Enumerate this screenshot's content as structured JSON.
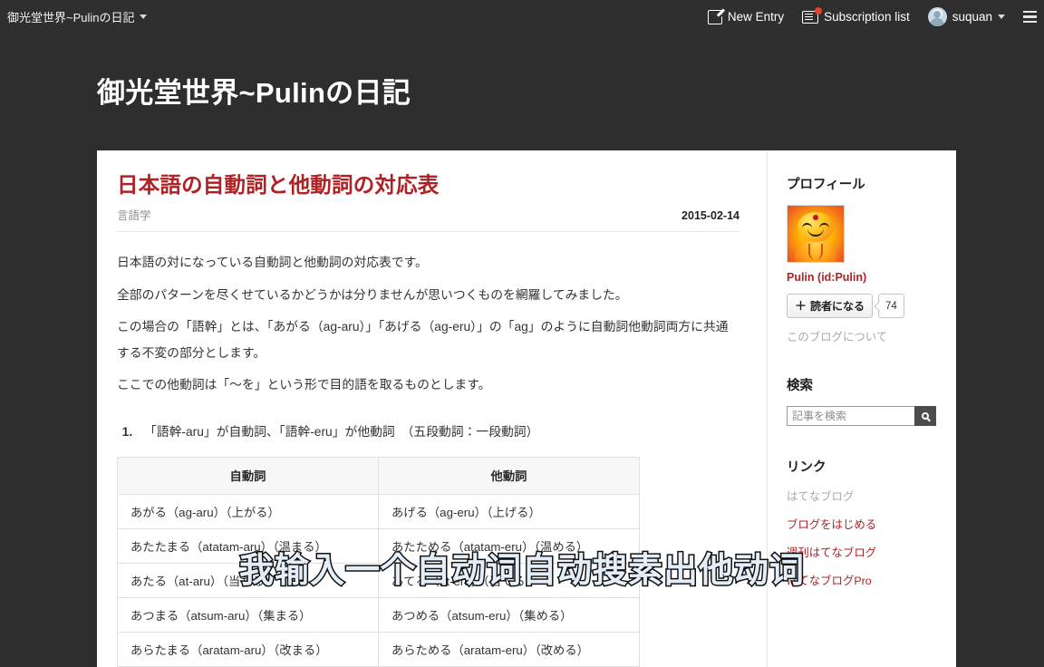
{
  "globalheader": {
    "blog_name": "御光堂世界~Pulinの日記",
    "new_entry_label": "New Entry",
    "subscription_label": "Subscription list",
    "user_name": "suquan"
  },
  "blog": {
    "title": "御光堂世界~Pulinの日記"
  },
  "entry": {
    "title": "日本語の自動詞と他動詞の対応表",
    "category": "言語学",
    "date": "2015-02-14",
    "paragraphs": [
      "日本語の対になっている自動詞と他動詞の対応表です。",
      "全部のパターンを尽くせているかどうかは分りませんが思いつくものを網羅してみました。",
      "この場合の「語幹」とは、「あがる（ag-aru）」「あげる（ag-eru）」の「ag」のように自動詞他動詞両方に共通する不変の部分とします。",
      "ここでの他動詞は「〜を」という形で目的語を取るものとします。"
    ],
    "rule_1": "「語幹-aru」が自動詞、「語幹-eru」が他動詞　（五段動詞：一段動詞）",
    "table": {
      "headers": [
        "自動詞",
        "他動詞"
      ],
      "rows": [
        [
          "あがる（ag-aru）（上がる）",
          "あげる（ag-eru）（上げる）"
        ],
        [
          "あたたまる（atatam-aru）（温まる）",
          "あたためる（atatam-eru）（温める）"
        ],
        [
          "あたる（at-aru）（当たる）",
          "あてる（at-eru）（当てる）"
        ],
        [
          "あつまる（atsum-aru）（集まる）",
          "あつめる（atsum-eru）（集める）"
        ],
        [
          "あらたまる（aratam-aru）（改まる）",
          "あらためる（aratam-eru）（改める）"
        ]
      ]
    }
  },
  "sidebar": {
    "profile": {
      "heading": "プロフィール",
      "name": "Pulin (id:Pulin)",
      "subscribe_label": "読者になる",
      "subscribe_plus": "＋",
      "subscriber_count": "74",
      "about_link": "このブログについて"
    },
    "search": {
      "heading": "検索",
      "placeholder": "記事を検索"
    },
    "links": {
      "heading": "リンク",
      "items": [
        {
          "label": "はてなブログ",
          "muted": true
        },
        {
          "label": "ブログをはじめる",
          "muted": false
        },
        {
          "label": "週刊はてなブログ",
          "muted": false
        },
        {
          "label": "はてなブログPro",
          "muted": false
        }
      ]
    }
  },
  "caption": {
    "text": "我输入一个自动词自动搜素出他动词"
  },
  "colors": {
    "header_bg": "#2e2e2e",
    "accent_red": "#b02125",
    "badge_red": "#e8412c",
    "caption_fill": "#e3eef8"
  }
}
